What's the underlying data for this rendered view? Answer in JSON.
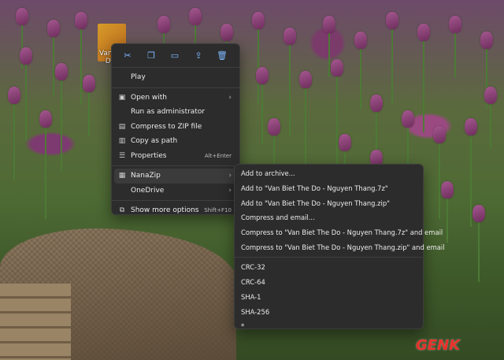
{
  "desktop_icon": {
    "label": "Van Bi Do"
  },
  "quick_actions": [
    {
      "name": "cut-icon",
      "glyph": "✂"
    },
    {
      "name": "copy-icon",
      "glyph": "❐"
    },
    {
      "name": "rename-icon",
      "glyph": "▭"
    },
    {
      "name": "share-icon",
      "glyph": "⇪"
    },
    {
      "name": "delete-icon",
      "glyph": "🗑"
    }
  ],
  "context_menu": {
    "items": [
      {
        "label": "Play",
        "icon": "",
        "shortcut": "",
        "arrow": false
      },
      {
        "label": "Open with",
        "icon": "open-with-icon",
        "glyph": "▣",
        "shortcut": "",
        "arrow": true
      },
      {
        "label": "Run as administrator",
        "icon": "",
        "shortcut": "",
        "arrow": false
      },
      {
        "label": "Compress to ZIP file",
        "icon": "zip-icon",
        "glyph": "▤",
        "shortcut": "",
        "arrow": false
      },
      {
        "label": "Copy as path",
        "icon": "copy-path-icon",
        "glyph": "▥",
        "shortcut": "",
        "arrow": false
      },
      {
        "label": "Properties",
        "icon": "properties-icon",
        "glyph": "☰",
        "shortcut": "Alt+Enter",
        "arrow": false
      },
      {
        "label": "NanaZip",
        "icon": "nanazip-icon",
        "glyph": "▦",
        "shortcut": "",
        "arrow": true
      },
      {
        "label": "OneDrive",
        "icon": "",
        "shortcut": "",
        "arrow": true
      },
      {
        "label": "Show more options",
        "icon": "more-options-icon",
        "glyph": "⧉",
        "shortcut": "Shift+F10",
        "arrow": false
      }
    ]
  },
  "nanazip_submenu": {
    "items": [
      "Add to archive...",
      "Add to \"Van Biet The Do - Nguyen Thang.7z\"",
      "Add to \"Van Biet The Do - Nguyen Thang.zip\"",
      "Compress and email...",
      "Compress to \"Van Biet The Do - Nguyen Thang.7z\" and email",
      "Compress to \"Van Biet The Do - Nguyen Thang.zip\" and email",
      "CRC-32",
      "CRC-64",
      "SHA-1",
      "SHA-256",
      "*"
    ]
  },
  "watermark": {
    "text": "GENK",
    "color": "#e8312b"
  }
}
